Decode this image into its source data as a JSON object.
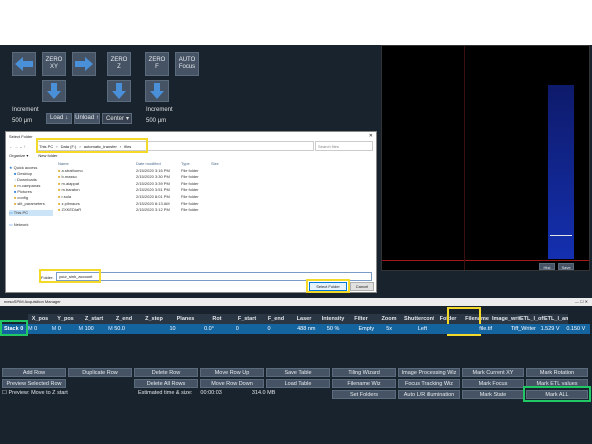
{
  "controls": {
    "zero_xy": "ZERO\nXY",
    "zero_z": "ZERO\nZ",
    "zero_f": "ZERO\nF",
    "auto_focus": "AUTO\nFocus",
    "increment_label_left": "Increment",
    "increment_label_right": "Increment",
    "increment_value_left": "500 µm",
    "increment_value_right": "500 µm",
    "load_button": "Load ↓",
    "unload_button": "Unload ↑",
    "center_combo": "Center"
  },
  "viewer": {
    "buttons": [
      "Hist",
      "Save"
    ]
  },
  "dialog": {
    "title": "Select Folder",
    "breadcrumb": [
      "This PC",
      "Data (F:)",
      "automatic_transfer",
      "files"
    ],
    "search_placeholder": "Search files",
    "toolbar": [
      "Organize ▾",
      "New folder"
    ],
    "tree": [
      {
        "label": "Quick access",
        "level": 0
      },
      {
        "label": "Desktop",
        "level": 1
      },
      {
        "label": "Downloads",
        "level": 1
      },
      {
        "label": "m.campanas",
        "level": 1
      },
      {
        "label": "Pictures",
        "level": 1
      },
      {
        "label": "config",
        "level": 1
      },
      {
        "label": "slit_parameters",
        "level": 1
      },
      {
        "label": "This PC",
        "level": 0
      },
      {
        "label": "Network",
        "level": 0
      }
    ],
    "columns": [
      "Name",
      "Date modified",
      "Type",
      "Size"
    ],
    "files": [
      {
        "name": "a.strathomo",
        "date": "2/15/2020 3:16 PM",
        "type": "File folder"
      },
      {
        "name": "b.masso",
        "date": "2/15/2020 3:30 PM",
        "type": "File folder"
      },
      {
        "name": "m.alappat",
        "date": "2/15/2020 3:39 PM",
        "type": "File folder"
      },
      {
        "name": "m.baraton",
        "date": "2/15/2020 3:51 PM",
        "type": "File folder"
      },
      {
        "name": "r.sola",
        "date": "2/15/2020 8:01 PM",
        "type": "File folder"
      },
      {
        "name": "z.plimaurs",
        "date": "2/15/2020 8:13 AM",
        "type": "File folder"
      },
      {
        "name": "ZXKEDIaR",
        "date": "2/15/2020 3:12 PM",
        "type": "File folder"
      }
    ],
    "folder_label": "Folder:",
    "folder_value": "your_sink_account",
    "select_button": "Select Folder",
    "cancel_button": "Cancel"
  },
  "acq": {
    "window_title": "mesoSPIM Acquisition Manager",
    "columns": [
      "X_pos",
      "Y_pos",
      "Z_start",
      "Z_end",
      "Z_step",
      "Planes",
      "Rot",
      "F_start",
      "F_end",
      "Laser",
      "Intensity",
      "Filter",
      "Zoom",
      "Shutterconfig",
      "Folder",
      "Filename",
      "Image_writer_plugin",
      "ETL_l_offset",
      "ETL_l_amp"
    ],
    "row_label": "Stack 0",
    "row": [
      "M",
      "0",
      "M",
      "0",
      "M",
      "100",
      "M",
      "50.0",
      "10",
      "0.0°",
      "0",
      "0",
      "488 nm",
      "50 %",
      "Empty",
      "5x",
      "Left",
      "",
      "file.tif",
      "Tiff_Writer",
      "1.529 V",
      "0.150 V"
    ],
    "buttons": [
      [
        "Add Row",
        "Duplicate Row",
        "Delete Row",
        "Move Row Up",
        "Save Table",
        "Tiling Wizard",
        "Image Processing Wiz",
        "Mark Current XY",
        "Mark Rotation"
      ],
      [
        "Preview Selected Row",
        "",
        "Delete All Rows",
        "Move Row Down",
        "Load Table",
        "Filename Wiz",
        "Focus Tracking Wiz",
        "Mark Focus",
        "Mark ETL values"
      ],
      [
        "",
        "",
        "",
        "",
        "",
        "Set Folders",
        "Auto L/R illumination",
        "Mark State",
        "Mark ALL"
      ]
    ],
    "status": {
      "preview": "Preview: Move to Z start",
      "estimated_label": "Estimated time & size:",
      "time": "00:00:03",
      "size": "314.0 MB"
    }
  },
  "colors": {
    "app_bg": "#19232d",
    "button_bg": "#455364",
    "arrow_blue": "#4a90d9",
    "highlight_yellow": "#f3d92a",
    "highlight_green": "#22c765",
    "selected_row": "#1464a0"
  }
}
